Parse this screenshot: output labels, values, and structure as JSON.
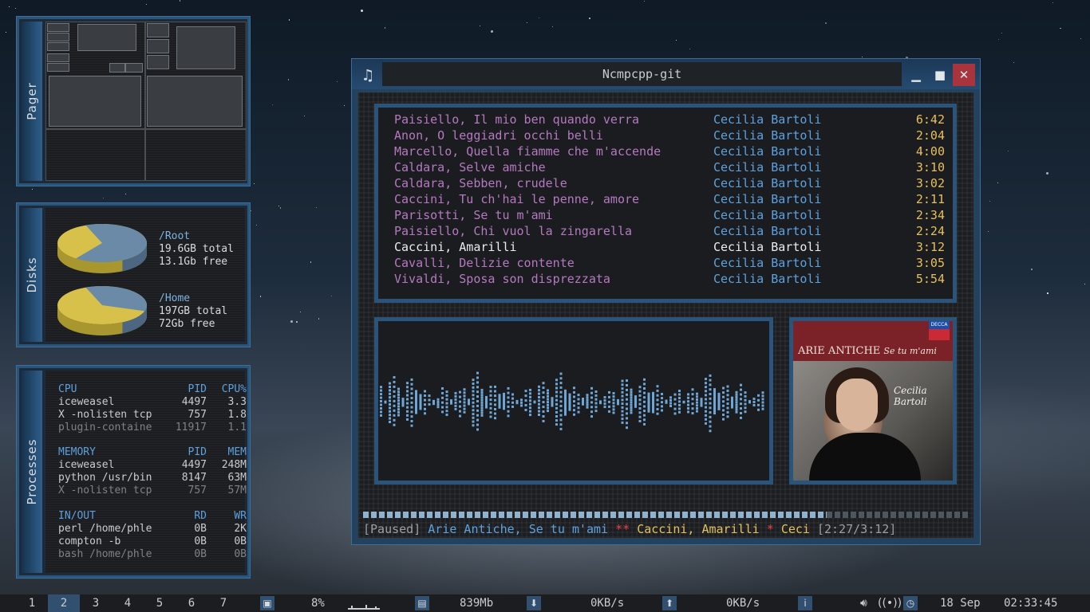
{
  "pager": {
    "label": "Pager"
  },
  "disks": {
    "label": "Disks",
    "items": [
      {
        "mount": "/Root",
        "total": "19.6GB total",
        "free": "13.1Gb free",
        "used_fraction": 0.34
      },
      {
        "mount": "/Home",
        "total": "197GB total",
        "free": "72Gb free",
        "used_fraction": 0.64
      }
    ],
    "colors": {
      "used": "#d8c14a",
      "free": "#6b8aa8"
    }
  },
  "processes": {
    "label": "Processes",
    "cpu": {
      "headers": [
        "CPU",
        "PID",
        "CPU%"
      ],
      "rows": [
        [
          "iceweasel",
          "4497",
          "3.3"
        ],
        [
          "X -nolisten tcp",
          "757",
          "1.8"
        ],
        [
          "plugin-containe",
          "11917",
          "1.1"
        ]
      ]
    },
    "memory": {
      "headers": [
        "MEMORY",
        "PID",
        "MEM"
      ],
      "rows": [
        [
          "iceweasel",
          "4497",
          "248M"
        ],
        [
          "python /usr/bin",
          "8147",
          "63M"
        ],
        [
          "X -nolisten tcp",
          "757",
          "57M"
        ]
      ]
    },
    "io": {
      "headers": [
        "IN/OUT",
        "RD",
        "WR"
      ],
      "rows": [
        [
          "perl /home/phle",
          "0B",
          "2K"
        ],
        [
          "compton -b",
          "0B",
          "0B"
        ],
        [
          "bash /home/phle",
          "0B",
          "0B"
        ]
      ]
    }
  },
  "window": {
    "title": "Ncmpcpp-git",
    "icons": {
      "app": "music-note-icon",
      "minimize": "minimize-icon",
      "maximize": "maximize-icon",
      "close": "close-icon"
    }
  },
  "playlist": [
    {
      "title": "Paisiello, Il mio ben quando verra",
      "artist": "Cecilia Bartoli",
      "duration": "6:42"
    },
    {
      "title": "Anon, O leggiadri occhi belli",
      "artist": "Cecilia Bartoli",
      "duration": "2:04"
    },
    {
      "title": "Marcello, Quella fiamme che m'accende",
      "artist": "Cecilia Bartoli",
      "duration": "4:00"
    },
    {
      "title": "Caldara, Selve amiche",
      "artist": "Cecilia Bartoli",
      "duration": "3:10"
    },
    {
      "title": "Caldara, Sebben, crudele",
      "artist": "Cecilia Bartoli",
      "duration": "3:02"
    },
    {
      "title": "Caccini, Tu ch'hai le penne, amore",
      "artist": "Cecilia Bartoli",
      "duration": "2:11"
    },
    {
      "title": "Parisotti, Se tu m'ami",
      "artist": "Cecilia Bartoli",
      "duration": "2:34"
    },
    {
      "title": "Paisiello, Chi vuol la zingarella",
      "artist": "Cecilia Bartoli",
      "duration": "2:24"
    },
    {
      "title": "Caccini, Amarilli",
      "artist": "Cecilia Bartoli",
      "duration": "3:12",
      "current": true
    },
    {
      "title": "Cavalli, Delizie contente",
      "artist": "Cecilia Bartoli",
      "duration": "3:05"
    },
    {
      "title": "Vivaldi, Sposa son disprezzata",
      "artist": "Cecilia Bartoli",
      "duration": "5:54"
    }
  ],
  "album_art": {
    "heading": "ARIE ANTICHE",
    "subheading": "Se tu m'ami",
    "artist_line1": "Cecilia",
    "artist_line2": "Bartoli",
    "label": "DECCA"
  },
  "status": {
    "state": "[Paused]",
    "album": "Arie Antiche, Se tu m'ami",
    "sep1": "**",
    "song": "Caccini, Amarilli",
    "sep2": "*",
    "artist": "Ceci",
    "time": "[2:27/3:12]",
    "progress_fraction": 0.766
  },
  "taskbar": {
    "workspaces": [
      "1",
      "2",
      "3",
      "4",
      "5",
      "6",
      "7"
    ],
    "active_workspace": 1,
    "cpu_percent": "8%",
    "memory": "839Mb",
    "download": "0KB/s",
    "upload": "0KB/s",
    "date": "18 Sep",
    "time": "02:33:45",
    "icons": [
      "cpu-icon",
      "memory-icon",
      "download-icon",
      "upload-icon",
      "info-icon",
      "volume-icon",
      "wifi-icon",
      "clock-icon"
    ]
  }
}
